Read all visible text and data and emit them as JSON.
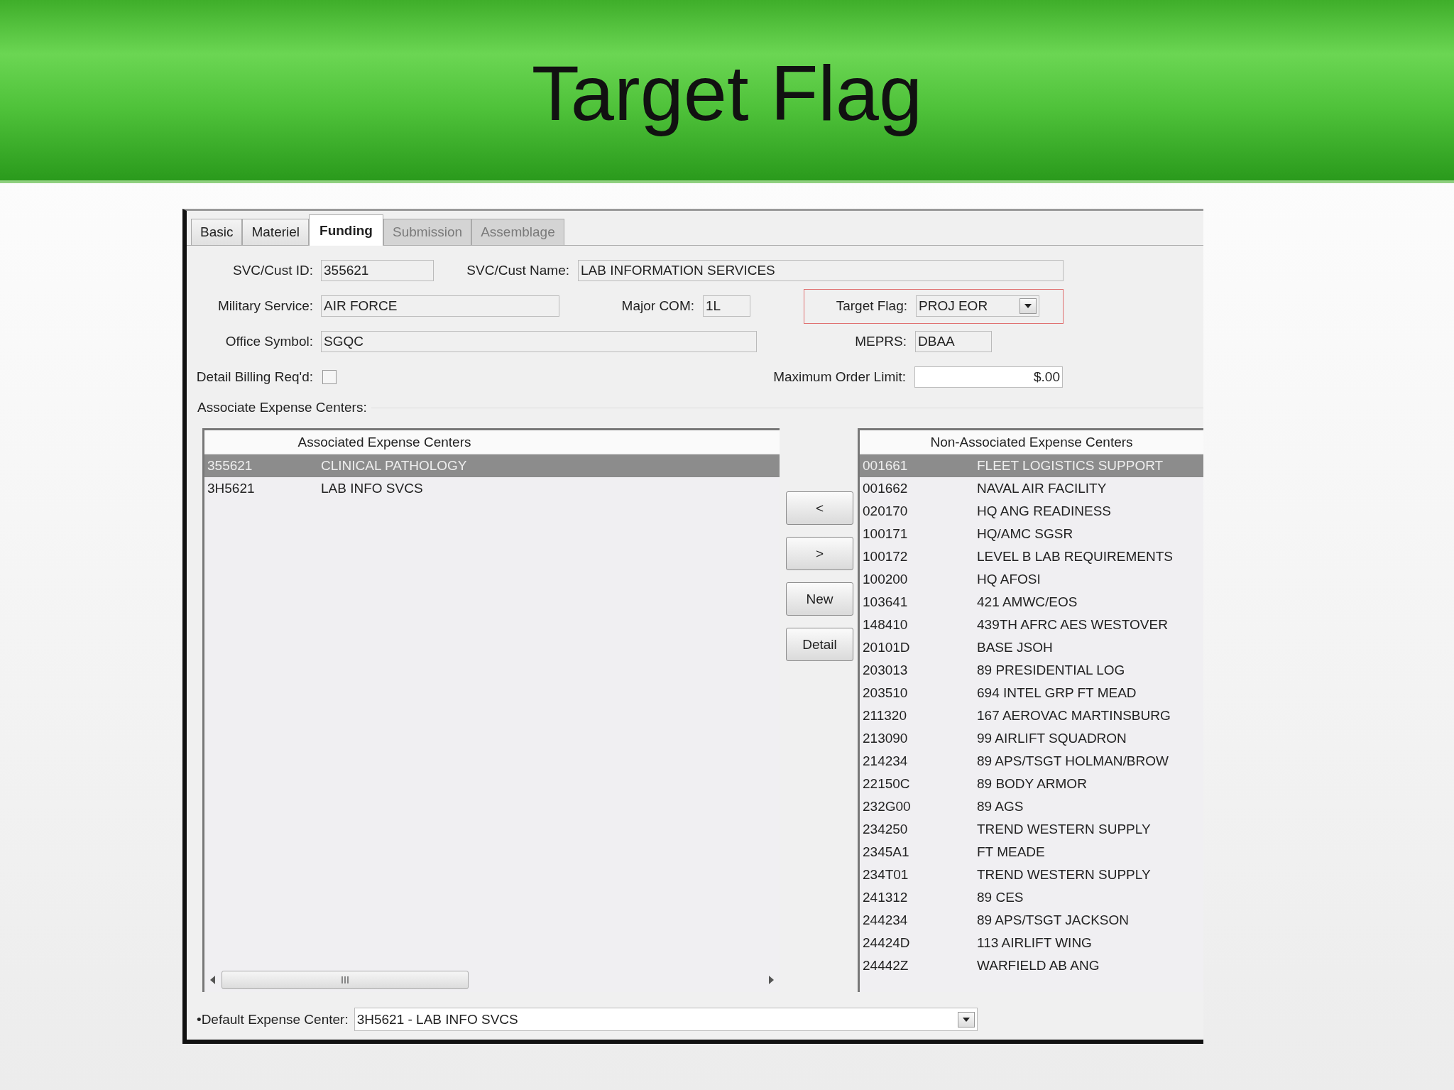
{
  "slide_title": "Target Flag",
  "tabs": [
    {
      "label": "Basic",
      "selected": false,
      "disabled": false
    },
    {
      "label": "Materiel",
      "selected": false,
      "disabled": false
    },
    {
      "label": "Funding",
      "selected": true,
      "disabled": false
    },
    {
      "label": "Submission",
      "selected": false,
      "disabled": true
    },
    {
      "label": "Assemblage",
      "selected": false,
      "disabled": true
    }
  ],
  "form": {
    "svc_cust_id": {
      "label": "SVC/Cust ID:",
      "value": "355621"
    },
    "svc_cust_name": {
      "label": "SVC/Cust Name:",
      "value": "LAB INFORMATION SERVICES"
    },
    "military_service": {
      "label": "Military Service:",
      "value": "AIR FORCE"
    },
    "major_com": {
      "label": "Major COM:",
      "value": "1L"
    },
    "target_flag": {
      "label": "Target Flag:",
      "value": "PROJ EOR",
      "highlighted": true
    },
    "office_symbol": {
      "label": "Office Symbol:",
      "value": "SGQC"
    },
    "meprs": {
      "label": "MEPRS:",
      "value": "DBAA"
    },
    "detail_billing": {
      "label": "Detail Billing Req'd:",
      "checked": false
    },
    "max_order_limit": {
      "label": "Maximum Order Limit:",
      "value": "$.00"
    }
  },
  "associate_section": {
    "label": "Associate Expense Centers:"
  },
  "associated_list": {
    "columns": [
      "Associated Expense Centers"
    ],
    "rows": [
      {
        "code": "355621",
        "name": "CLINICAL PATHOLOGY",
        "selected": true
      },
      {
        "code": "3H5621",
        "name": "LAB INFO SVCS",
        "selected": false
      }
    ]
  },
  "buttons": [
    "<",
    ">",
    "New",
    "Detail"
  ],
  "non_associated_list": {
    "columns": [
      "Non-Associated Expense Centers"
    ],
    "rows": [
      {
        "code": "001661",
        "name": "FLEET LOGISTICS SUPPORT",
        "selected": true
      },
      {
        "code": "001662",
        "name": "NAVAL AIR FACILITY",
        "selected": false
      },
      {
        "code": "020170",
        "name": "HQ ANG READINESS",
        "selected": false
      },
      {
        "code": "100171",
        "name": "HQ/AMC SGSR",
        "selected": false
      },
      {
        "code": "100172",
        "name": "LEVEL B LAB REQUIREMENTS",
        "selected": false
      },
      {
        "code": "100200",
        "name": "HQ AFOSI",
        "selected": false
      },
      {
        "code": "103641",
        "name": "421 AMWC/EOS",
        "selected": false
      },
      {
        "code": "148410",
        "name": "439TH AFRC AES WESTOVER",
        "selected": false
      },
      {
        "code": "20101D",
        "name": "BASE JSOH",
        "selected": false
      },
      {
        "code": "203013",
        "name": "89 PRESIDENTIAL LOG",
        "selected": false
      },
      {
        "code": "203510",
        "name": "694 INTEL GRP FT MEAD",
        "selected": false
      },
      {
        "code": "211320",
        "name": "167 AEROVAC MARTINSBURG",
        "selected": false
      },
      {
        "code": "213090",
        "name": "99 AIRLIFT SQUADRON",
        "selected": false
      },
      {
        "code": "214234",
        "name": "89 APS/TSGT HOLMAN/BROW",
        "selected": false
      },
      {
        "code": "22150C",
        "name": "89 BODY ARMOR",
        "selected": false
      },
      {
        "code": "232G00",
        "name": "89 AGS",
        "selected": false
      },
      {
        "code": "234250",
        "name": "TREND WESTERN SUPPLY",
        "selected": false
      },
      {
        "code": "2345A1",
        "name": "FT MEADE",
        "selected": false
      },
      {
        "code": "234T01",
        "name": "TREND WESTERN SUPPLY",
        "selected": false
      },
      {
        "code": "241312",
        "name": "89 CES",
        "selected": false
      },
      {
        "code": "244234",
        "name": "89 APS/TSGT JACKSON",
        "selected": false
      },
      {
        "code": "24424D",
        "name": "113  AIRLIFT WING",
        "selected": false
      },
      {
        "code": "24442Z",
        "name": "WARFIELD AB ANG",
        "selected": false
      }
    ]
  },
  "default_expense_center": {
    "label": "•Default Expense Center:",
    "value": "3H5621 - LAB INFO SVCS"
  }
}
